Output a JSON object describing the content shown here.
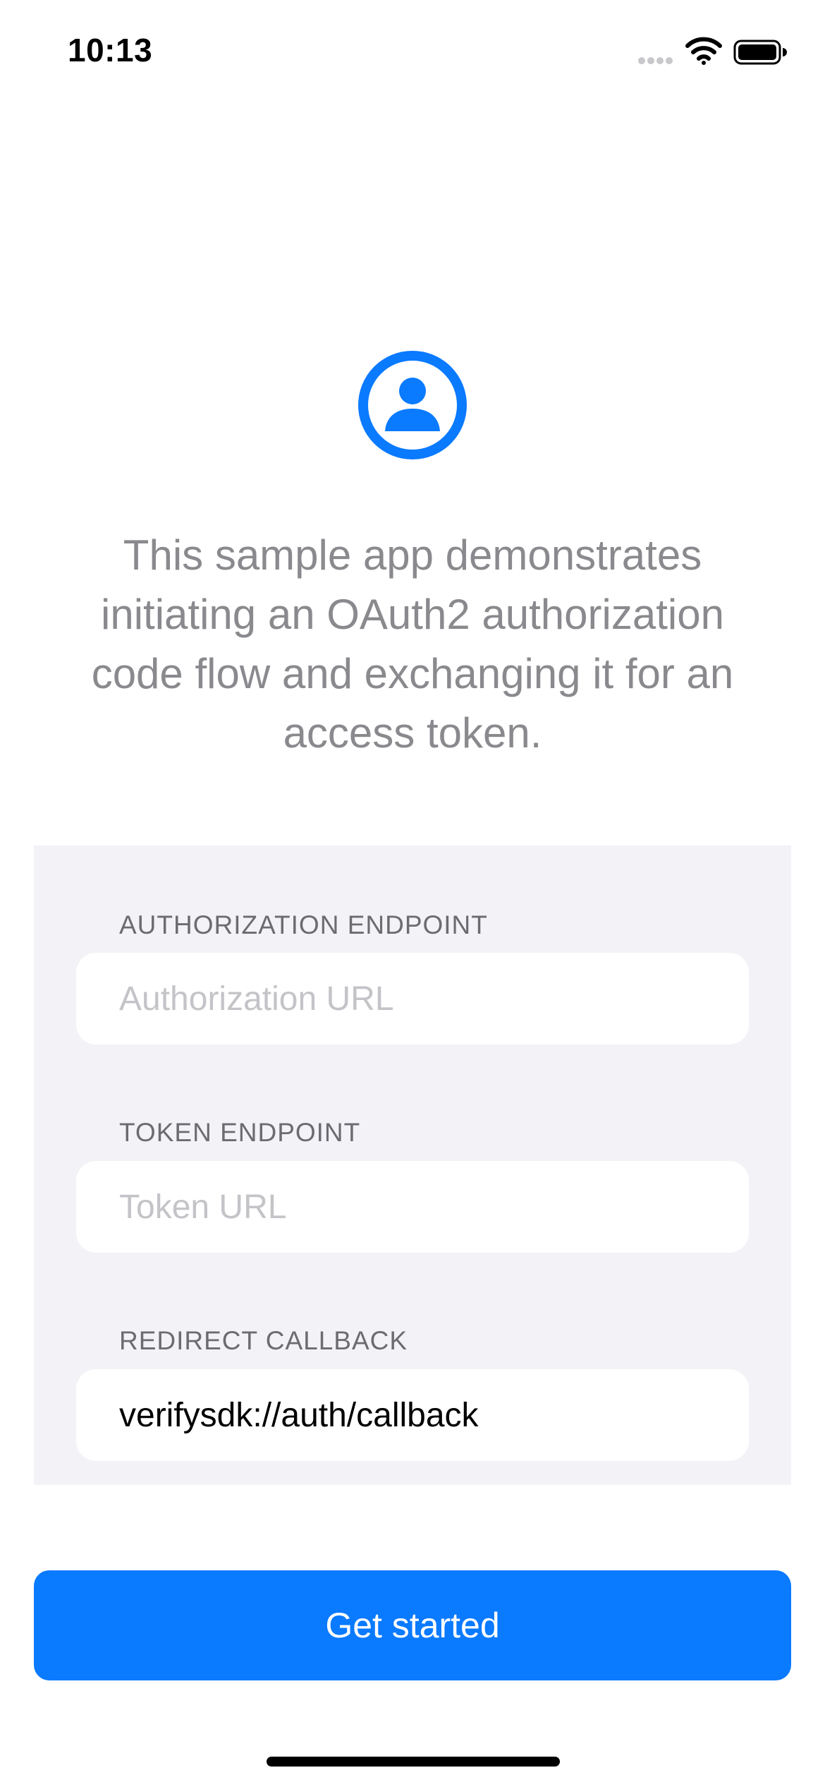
{
  "status_bar": {
    "time": "10:13",
    "icons": [
      "signal-icon",
      "wifi-icon",
      "battery-icon"
    ]
  },
  "hero": {
    "icon": "person-circle-icon",
    "accent_color": "#0a7aff",
    "description": "This sample app demonstrates initiating an OAuth2 authorization code flow and exchanging it for an access token."
  },
  "form": {
    "authorization": {
      "label": "AUTHORIZATION ENDPOINT",
      "placeholder": "Authorization URL",
      "value": ""
    },
    "token": {
      "label": "TOKEN ENDPOINT",
      "placeholder": "Token URL",
      "value": ""
    },
    "redirect": {
      "label": "REDIRECT CALLBACK",
      "placeholder": "",
      "value": "verifysdk://auth/callback"
    }
  },
  "actions": {
    "get_started_label": "Get started"
  },
  "colors": {
    "accent": "#0a7aff",
    "panel_background": "#f2f2f7",
    "secondary_text": "#8a8a8e"
  }
}
